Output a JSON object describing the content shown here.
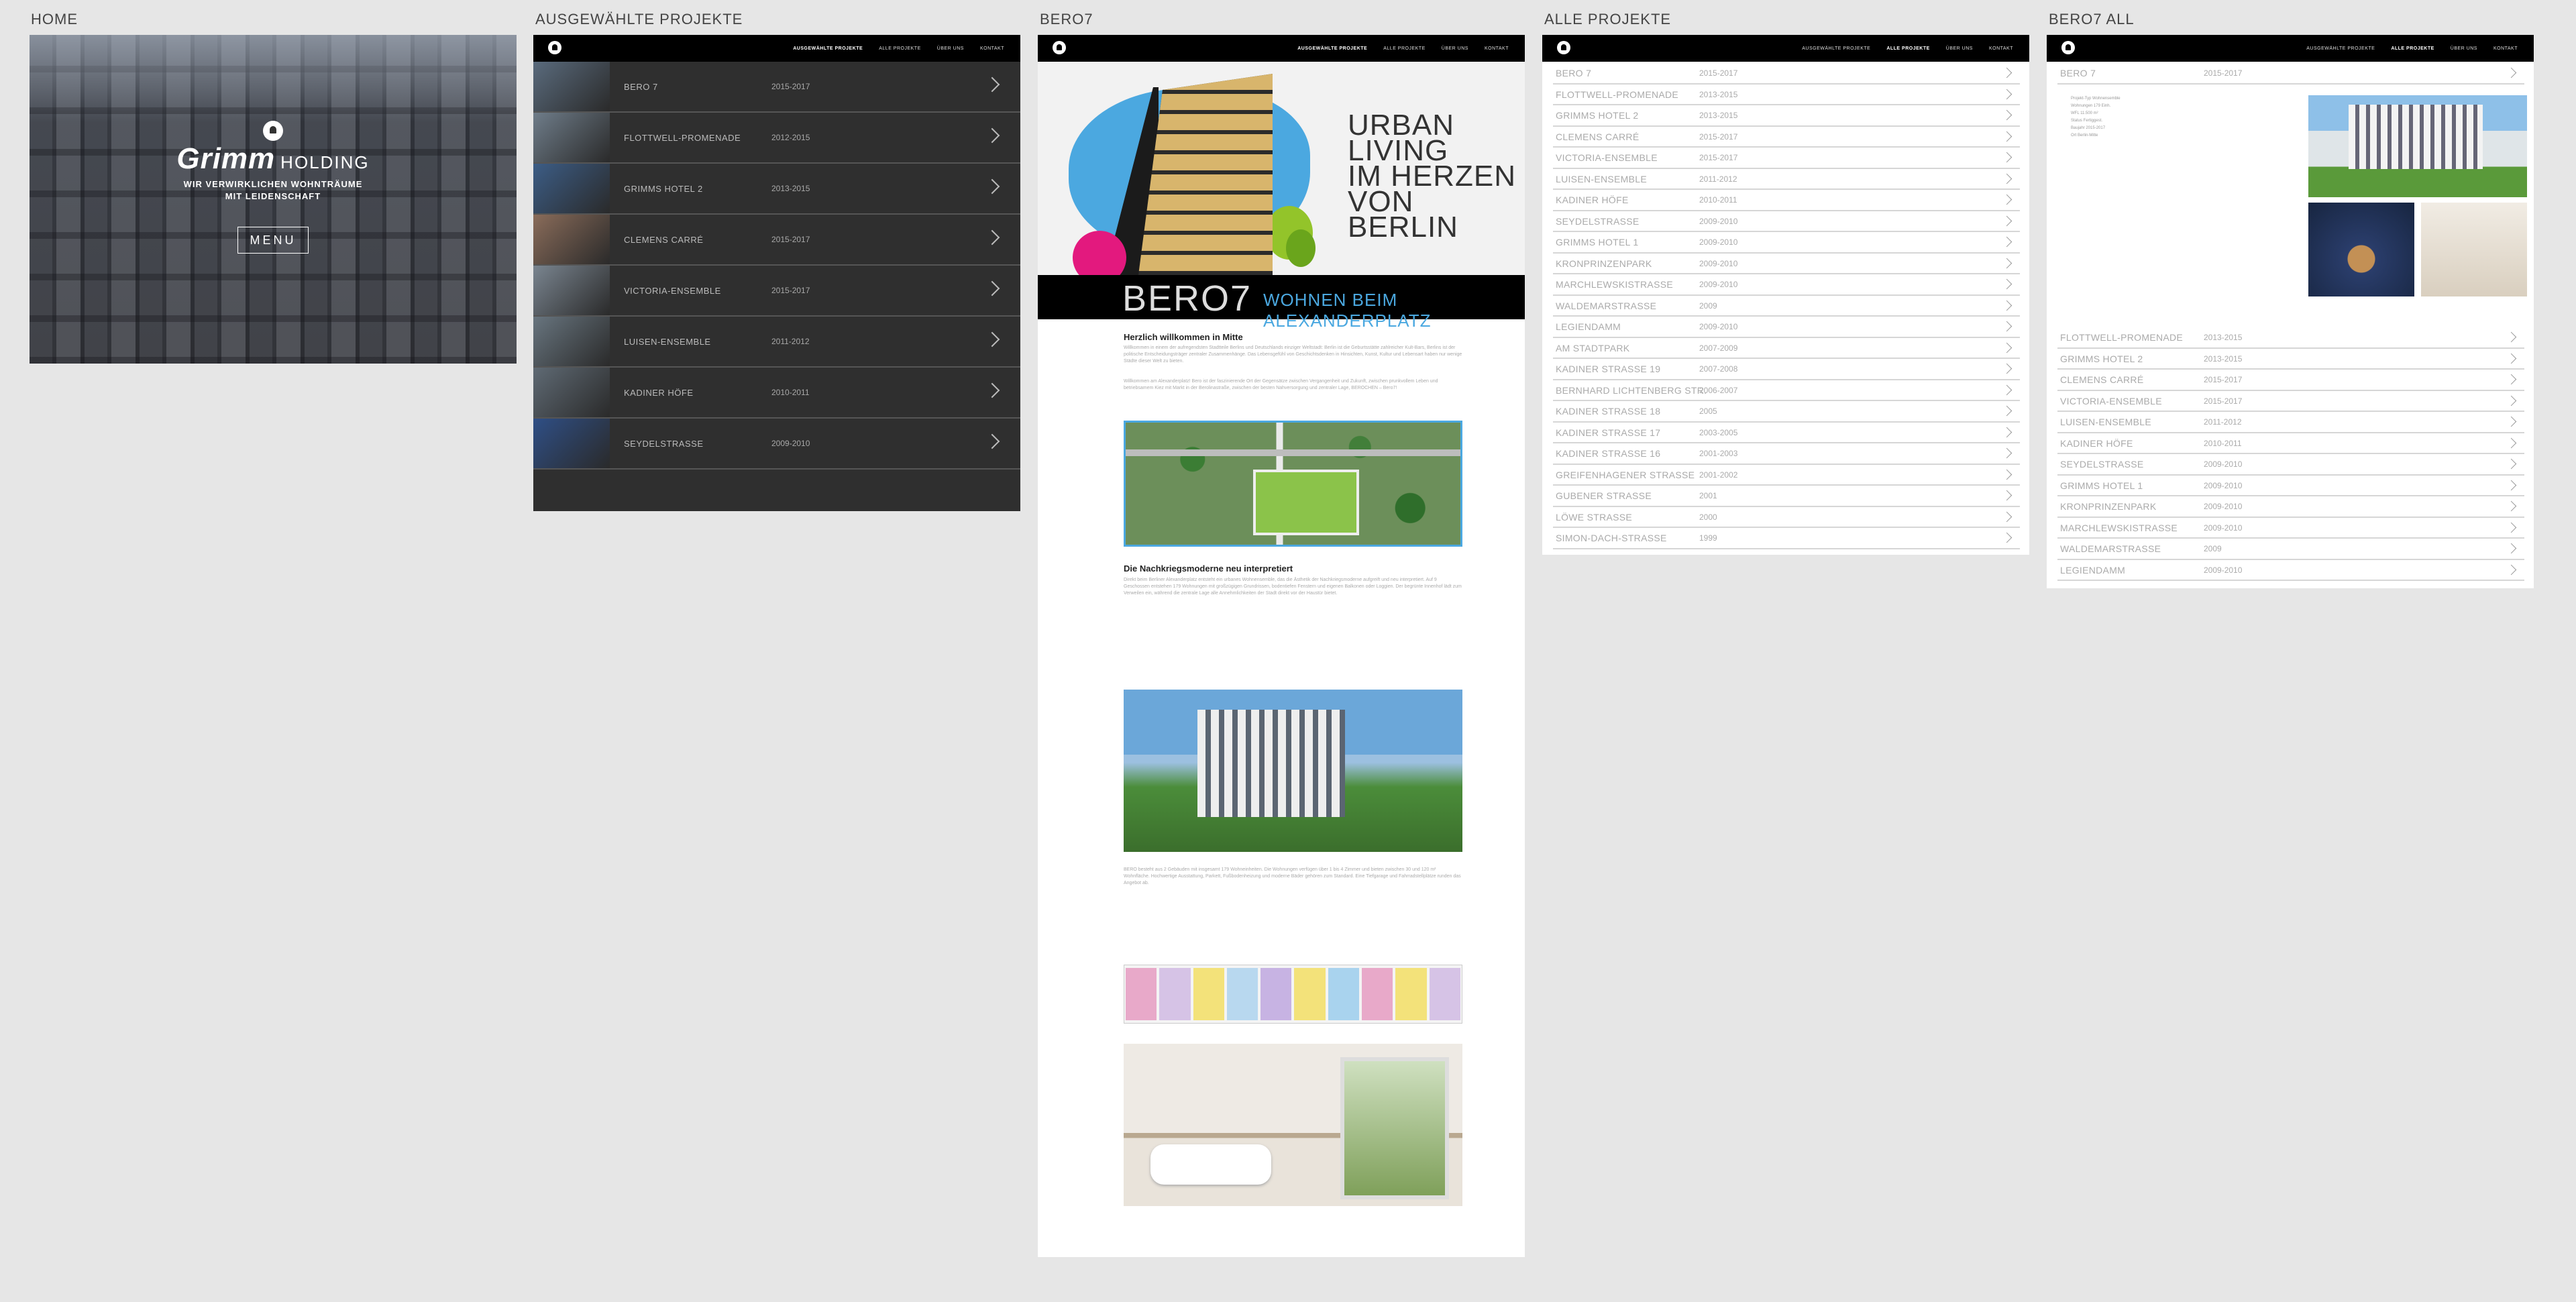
{
  "labels": {
    "home": "HOME",
    "ausgewaehlt": "AUSGEWÄHLTE PROJEKTE",
    "bero7": "BERO7",
    "alle": "ALLE PROJEKTE",
    "bero7all": "BERO7 ALL"
  },
  "nav": [
    "AUSGEWÄHLTE PROJEKTE",
    "ALLE PROJEKTE",
    "ÜBER UNS",
    "KONTAKT"
  ],
  "home": {
    "brand_main": "Grimm",
    "brand_sub": "HOLDING",
    "tagline_1": "WIR VERWIRKLICHEN WOHNTRÄUME",
    "tagline_2": "MIT LEIDENSCHAFT",
    "menu": "MENU"
  },
  "featured": [
    {
      "name": "BERO 7",
      "year": "2015-2017",
      "color": "#5a6b7d"
    },
    {
      "name": "FLOTTWELL-PROMENADE",
      "year": "2012-2015",
      "color": "#6f7d8a"
    },
    {
      "name": "GRIMMS HOTEL 2",
      "year": "2013-2015",
      "color": "#3c5d86"
    },
    {
      "name": "CLEMENS CARRÉ",
      "year": "2015-2017",
      "color": "#8a6c5a"
    },
    {
      "name": "VICTORIA-ENSEMBLE",
      "year": "2015-2017",
      "color": "#7a8590"
    },
    {
      "name": "LUISEN-ENSEMBLE",
      "year": "2011-2012",
      "color": "#68757f"
    },
    {
      "name": "KADINER HÖFE",
      "year": "2010-2011",
      "color": "#5f6a74"
    },
    {
      "name": "SEYDELSTRASSE",
      "year": "2009-2010",
      "color": "#2f4f86"
    }
  ],
  "bero7": {
    "hero_lines": [
      "URBAN",
      "LIVING",
      "IM HERZEN",
      "VON",
      "BERLIN"
    ],
    "logo": "BERO7",
    "claim": "WOHNEN BEIM ALEXANDERPLATZ",
    "h1": "Herzlich willkommen in Mitte",
    "p1": "Willkommen in einem der aufregendsten Stadtteile Berlins und Deutschlands einziger Weltstadt: Berlin ist die Geburtsstätte zahlreicher Kult-Bars, Berlins ist der politische Entscheidungsträger zentraler Zusammenhänge. Das Lebensgefühl von Geschichtsdenken in Hinsichten, Kunst, Kultur und Lebensart haben nur wenige Städte dieser Welt zu bieten.",
    "p2": "Willkommen am Alexanderplatz! Bero ist der faszinierende Ort der Gegensätze zwischen Vergangenheit und Zukunft, zwischen prunkvollem Leben und betriebsamem Kiez mit Markt in der Berolinastraße, zwischen der besten Nahversorgung und zentraler Lage, BEROCHEN – Bero7!",
    "h2": "Die Nachkriegsmoderne neu interpretiert",
    "p3": "Direkt beim Berliner Alexanderplatz entsteht ein urbanes Wohnensemble, das die Ästhetik der Nachkriegsmoderne aufgreift und neu interpretiert. Auf 9 Geschossen entstehen 179 Wohnungen mit großzügigen Grundrissen, bodentiefen Fenstern und eigenen Balkonen oder Loggien. Der begrünte Innenhof lädt zum Verweilen ein, während die zentrale Lage alle Annehmlichkeiten der Stadt direkt vor der Haustür bietet.",
    "p4": "BERO besteht aus 2 Gebäuden mit insgesamt 179 Wohneinheiten. Die Wohnungen verfügen über 1 bis 4 Zimmer und bieten zwischen 30 und 120 m² Wohnfläche. Hochwertige Ausstattung, Parkett, Fußbodenheizung und moderne Bäder gehören zum Standard. Eine Tiefgarage und Fahrradstellplätze runden das Angebot ab."
  },
  "all_projects": [
    {
      "name": "BERO 7",
      "year": "2015-2017"
    },
    {
      "name": "FLOTTWELL-PROMENADE",
      "year": "2013-2015"
    },
    {
      "name": "GRIMMS HOTEL 2",
      "year": "2013-2015"
    },
    {
      "name": "CLEMENS CARRÉ",
      "year": "2015-2017"
    },
    {
      "name": "VICTORIA-ENSEMBLE",
      "year": "2015-2017"
    },
    {
      "name": "LUISEN-ENSEMBLE",
      "year": "2011-2012"
    },
    {
      "name": "KADINER HÖFE",
      "year": "2010-2011"
    },
    {
      "name": "SEYDELSTRASSE",
      "year": "2009-2010"
    },
    {
      "name": "GRIMMS HOTEL 1",
      "year": "2009-2010"
    },
    {
      "name": "KRONPRINZENPARK",
      "year": "2009-2010"
    },
    {
      "name": "MARCHLEWSKISTRASSE",
      "year": "2009-2010"
    },
    {
      "name": "WALDEMARSTRASSE",
      "year": "2009"
    },
    {
      "name": "LEGIENDAMM",
      "year": "2009-2010"
    },
    {
      "name": "AM STADTPARK",
      "year": "2007-2009"
    },
    {
      "name": "KADINER STRASSE 19",
      "year": "2007-2008"
    },
    {
      "name": "BERNHARD LICHTENBERG STR.",
      "year": "2006-2007"
    },
    {
      "name": "KADINER STRASSE 18",
      "year": "2005"
    },
    {
      "name": "KADINER STRASSE 17",
      "year": "2003-2005"
    },
    {
      "name": "KADINER STRASSE 16",
      "year": "2001-2003"
    },
    {
      "name": "GREIFENHAGENER STRASSE",
      "year": "2001-2002"
    },
    {
      "name": "GUBENER STRASSE",
      "year": "2001"
    },
    {
      "name": "LÖWE STRASSE",
      "year": "2000"
    },
    {
      "name": "SIMON-DACH-STRASSE",
      "year": "1999"
    }
  ],
  "bero7all": {
    "head": {
      "name": "BERO 7",
      "year": "2015-2017"
    },
    "meta": [
      "Projekt-Typ    Wohnensemble",
      "Wohnungen    179 Einh.",
      "WFL    11.500 m²",
      "Status    Fertiggest.",
      "Baujahr    2015-2017",
      "Ort    Berlin-Mitte"
    ],
    "rows": [
      {
        "name": "FLOTTWELL-PROMENADE",
        "year": "2013-2015"
      },
      {
        "name": "GRIMMS HOTEL 2",
        "year": "2013-2015"
      },
      {
        "name": "CLEMENS CARRÉ",
        "year": "2015-2017"
      },
      {
        "name": "VICTORIA-ENSEMBLE",
        "year": "2015-2017"
      },
      {
        "name": "LUISEN-ENSEMBLE",
        "year": "2011-2012"
      },
      {
        "name": "KADINER HÖFE",
        "year": "2010-2011"
      },
      {
        "name": "SEYDELSTRASSE",
        "year": "2009-2010"
      },
      {
        "name": "GRIMMS HOTEL 1",
        "year": "2009-2010"
      },
      {
        "name": "KRONPRINZENPARK",
        "year": "2009-2010"
      },
      {
        "name": "MARCHLEWSKISTRASSE",
        "year": "2009-2010"
      },
      {
        "name": "WALDEMARSTRASSE",
        "year": "2009"
      },
      {
        "name": "LEGIENDAMM",
        "year": "2009-2010"
      }
    ]
  },
  "floorplan_colors": [
    "#e8a9c9",
    "#d6c3e6",
    "#f3e27a",
    "#b8d8ef",
    "#c7b3e3",
    "#f3e27a",
    "#a9d3ee",
    "#e8a9c9",
    "#f3e27a",
    "#d6c3e6"
  ]
}
